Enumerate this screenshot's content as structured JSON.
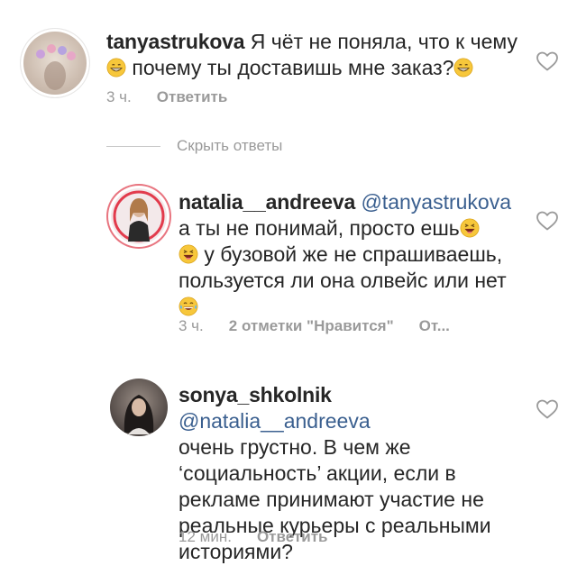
{
  "comments": [
    {
      "username": "tanyastrukova",
      "text_1": "Я чёт не поняла, что к чему",
      "text_2": "почему ты доставишь мне заказ?",
      "time": "3 ч.",
      "reply": "Ответить"
    },
    {
      "username": "natalia__andreeva",
      "mention": "@tanyastrukova",
      "line_1": "а ты не понимай, просто ешь",
      "line_2": "у бузовой же не спрашиваешь,",
      "line_3": "пользуется ли она олвейс или нет",
      "time": "3 ч.",
      "likes": "2 отметки \"Нравится\"",
      "reply": "От..."
    },
    {
      "username": "sonya_shkolnik",
      "mention": "@natalia__andreeva",
      "line_1": "очень грустно. В чем же",
      "line_2": "‘социальность’ акции, если в",
      "line_3": "рекламе принимают участие не",
      "line_4": "реальные курьеры с реальными",
      "line_5": "историями?",
      "time": "12 мин.",
      "reply": "Ответить"
    }
  ],
  "hide_replies": "Скрыть ответы",
  "colors": {
    "text": "#262626",
    "muted": "#9a9a9a",
    "mention": "#3a5f8f"
  },
  "icons": [
    "heart-outline-icon",
    "grinning-emoji-icon",
    "laughing-emoji-icon",
    "tears-of-joy-emoji-icon"
  ]
}
